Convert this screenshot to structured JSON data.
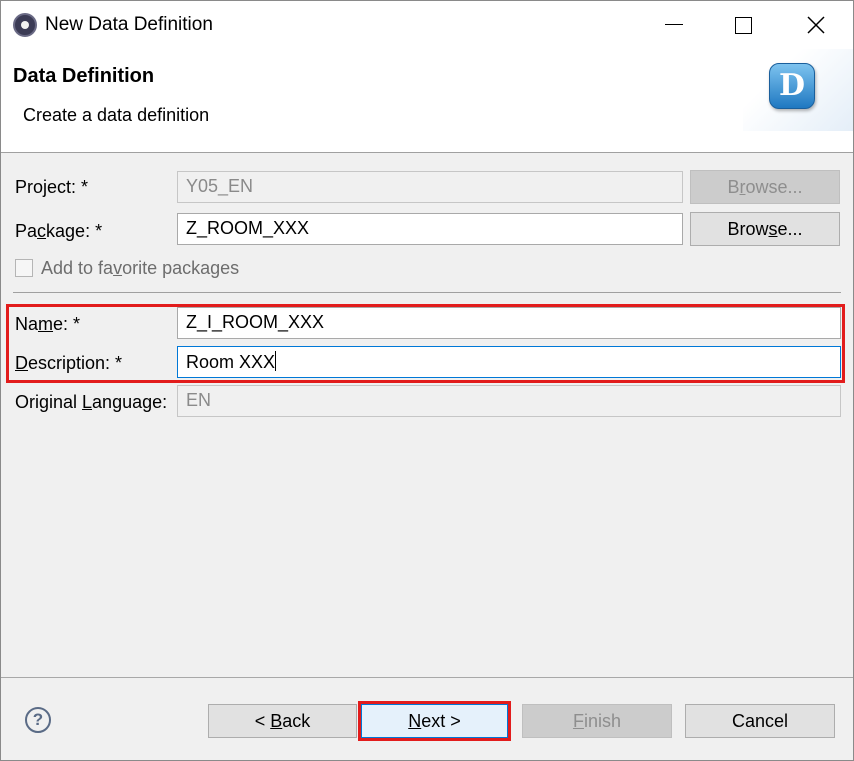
{
  "window": {
    "title": "New Data Definition"
  },
  "banner": {
    "title": "Data Definition",
    "subtitle": "Create a data definition",
    "icon_letter": "D"
  },
  "form": {
    "project": {
      "label_pre": "Project: *",
      "value": "Y05_EN",
      "browse_pre": "B",
      "browse_u": "r",
      "browse_post": "owse..."
    },
    "package": {
      "label_pre": "Pa",
      "label_u": "c",
      "label_post": "kage: *",
      "value": "Z_ROOM_XXX",
      "browse_pre": "Brow",
      "browse_u": "s",
      "browse_post": "e..."
    },
    "favorite": {
      "label_pre": "Add to fa",
      "label_u": "v",
      "label_post": "orite packages",
      "checked": false
    },
    "name": {
      "label_pre": "Na",
      "label_u": "m",
      "label_post": "e: *",
      "value": "Z_I_ROOM_XXX"
    },
    "description": {
      "label_u": "D",
      "label_post": "escription: *",
      "value": "Room XXX"
    },
    "language": {
      "label_pre": "Original ",
      "label_u": "L",
      "label_post": "anguage:",
      "value": "EN"
    }
  },
  "footer": {
    "help_glyph": "?",
    "back": {
      "pre": "< ",
      "u": "B",
      "post": "ack"
    },
    "next": {
      "u": "N",
      "post": "ext >"
    },
    "finish": {
      "u": "F",
      "post": "inish"
    },
    "cancel": "Cancel"
  },
  "colors": {
    "highlight": "#e21c1c",
    "focus": "#0078d7"
  }
}
